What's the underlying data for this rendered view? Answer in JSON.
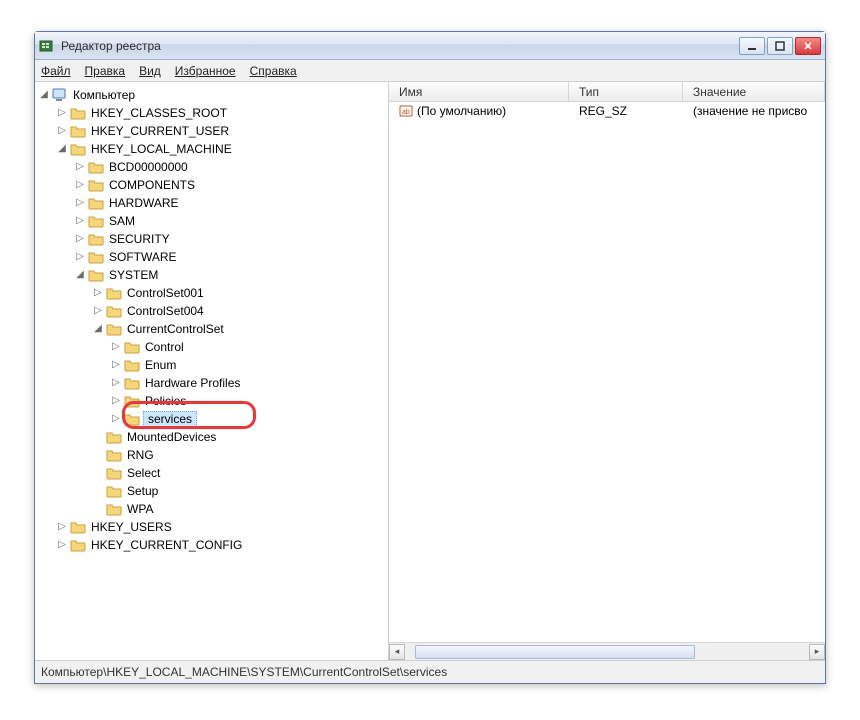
{
  "window": {
    "title": "Редактор реестра"
  },
  "menu": {
    "file": "Файл",
    "edit": "Правка",
    "view": "Вид",
    "favorites": "Избранное",
    "help": "Справка"
  },
  "tree": {
    "root": "Компьютер",
    "hkcr": "HKEY_CLASSES_ROOT",
    "hkcu": "HKEY_CURRENT_USER",
    "hklm": "HKEY_LOCAL_MACHINE",
    "hklm_children": {
      "bcd": "BCD00000000",
      "components": "COMPONENTS",
      "hardware": "HARDWARE",
      "sam": "SAM",
      "security": "SECURITY",
      "software": "SOFTWARE",
      "system": "SYSTEM",
      "system_children": {
        "cs001": "ControlSet001",
        "cs004": "ControlSet004",
        "ccs": "CurrentControlSet",
        "ccs_children": {
          "control": "Control",
          "enum": "Enum",
          "hwprofiles": "Hardware Profiles",
          "policies": "Policies",
          "services": "services"
        },
        "mounteddevices": "MountedDevices",
        "rng": "RNG",
        "select": "Select",
        "setup": "Setup",
        "wpa": "WPA"
      }
    },
    "hku": "HKEY_USERS",
    "hkcc": "HKEY_CURRENT_CONFIG"
  },
  "list": {
    "col_name": "Имя",
    "col_type": "Тип",
    "col_value": "Значение",
    "row0": {
      "name": "(По умолчанию)",
      "type": "REG_SZ",
      "value": "(значение не присво"
    }
  },
  "statusbar": {
    "path": "Компьютер\\HKEY_LOCAL_MACHINE\\SYSTEM\\CurrentControlSet\\services"
  },
  "glyphs": {
    "expand_open": "◢",
    "expand_closed": "▷"
  }
}
